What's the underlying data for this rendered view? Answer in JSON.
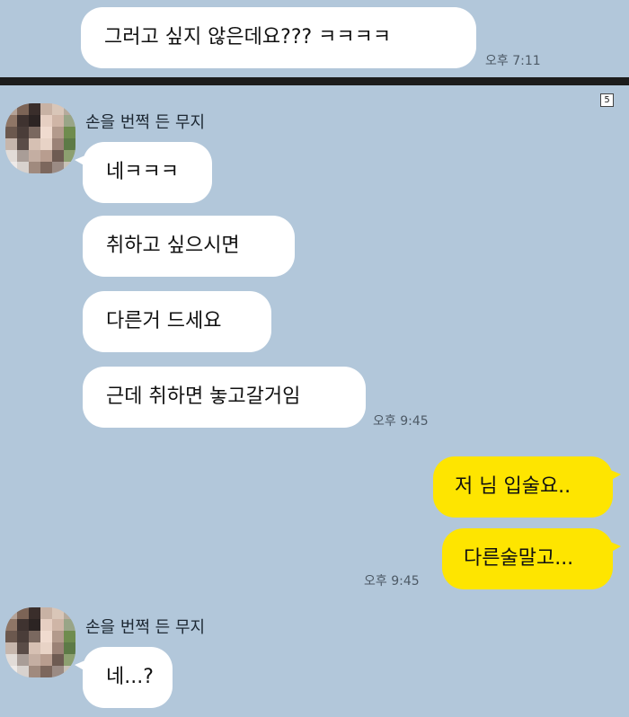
{
  "top": {
    "message": "그러고 싶지 않은데요??? ㅋㅋㅋㅋ",
    "time": "오후 7:11"
  },
  "badge": "5",
  "sender_name": "손을 번쩍 든 무지",
  "group1": {
    "messages": [
      "네ㅋㅋㅋ",
      "취하고 싶으시면",
      "다른거 드세요",
      "근데 취하면 놓고갈거임"
    ],
    "time": "오후 9:45"
  },
  "outgoing": {
    "messages": [
      "저 님 입술요..",
      "다른술말고..."
    ],
    "time": "오후 9:45"
  },
  "group2": {
    "messages": [
      "네...?"
    ]
  },
  "colors": {
    "background": "#b2c7da",
    "incoming_bubble": "#ffffff",
    "outgoing_bubble": "#fee500"
  }
}
